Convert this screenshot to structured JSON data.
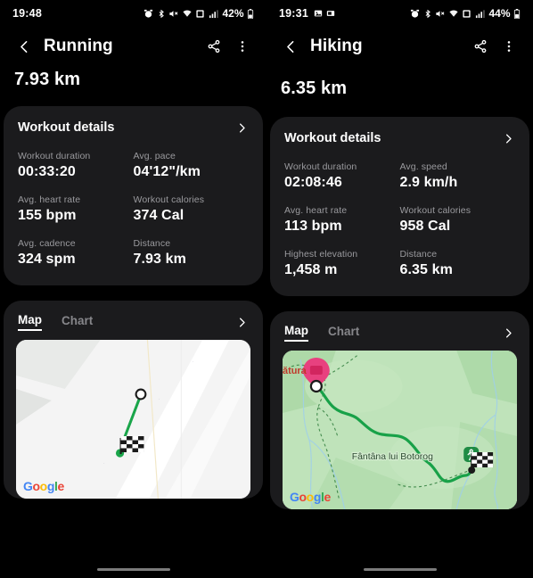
{
  "left": {
    "status": {
      "time": "19:48",
      "battery": "42%",
      "icons": [
        "alarm-icon",
        "bluetooth-icon",
        "mute-icon",
        "wifi-icon",
        "sim-icon",
        "signal-icon",
        "battery-icon"
      ]
    },
    "appbar": {
      "back": "back-icon",
      "title": "Running",
      "share": "share-icon",
      "more": "more-vert-icon"
    },
    "headline": "7.93 km",
    "details": {
      "title": "Workout details",
      "chevron": "chevron-right-icon",
      "metrics": [
        {
          "label": "Workout duration",
          "value": "00:33:20"
        },
        {
          "label": "Avg. pace",
          "value": "04'12\"/km"
        },
        {
          "label": "Avg. heart rate",
          "value": "155 bpm"
        },
        {
          "label": "Workout calories",
          "value": "374 Cal"
        },
        {
          "label": "Avg. cadence",
          "value": "324 spm"
        },
        {
          "label": "Distance",
          "value": "7.93 km"
        }
      ]
    },
    "map": {
      "tabs": [
        {
          "label": "Map",
          "active": true
        },
        {
          "label": "Chart",
          "active": false
        }
      ],
      "chevron": "chevron-right-icon",
      "watermark": "Google",
      "route_color": "#1aa54a",
      "style": "roadmap",
      "labels": []
    }
  },
  "right": {
    "status": {
      "time": "19:31",
      "battery": "44%",
      "left_icons": [
        "image-icon",
        "screenshot-icon"
      ],
      "icons": [
        "alarm-icon",
        "bluetooth-icon",
        "mute-icon",
        "wifi-icon",
        "sim-icon",
        "signal-icon",
        "battery-icon"
      ]
    },
    "appbar": {
      "back": "back-icon",
      "title": "Hiking",
      "share": "share-icon",
      "more": "more-vert-icon"
    },
    "headline": "6.35 km",
    "details": {
      "title": "Workout details",
      "chevron": "chevron-right-icon",
      "metrics": [
        {
          "label": "Workout duration",
          "value": "02:08:46"
        },
        {
          "label": "Avg. speed",
          "value": "2.9 km/h"
        },
        {
          "label": "Avg. heart rate",
          "value": "113 bpm"
        },
        {
          "label": "Workout calories",
          "value": "958 Cal"
        },
        {
          "label": "Highest elevation",
          "value": "1,458 m"
        },
        {
          "label": "Distance",
          "value": "6.35 km"
        }
      ]
    },
    "map": {
      "tabs": [
        {
          "label": "Map",
          "active": true
        },
        {
          "label": "Chart",
          "active": false
        }
      ],
      "chevron": "chevron-right-icon",
      "watermark": "Google",
      "route_color": "#18a148",
      "style": "terrain",
      "labels": [
        {
          "text": "ătura",
          "type": "place-label"
        },
        {
          "text": "Fântâna lui Botorog",
          "type": "place-label"
        }
      ],
      "markers": [
        "pink-pin-marker",
        "start-marker",
        "hiker-marker",
        "finish-flag-marker"
      ]
    }
  }
}
